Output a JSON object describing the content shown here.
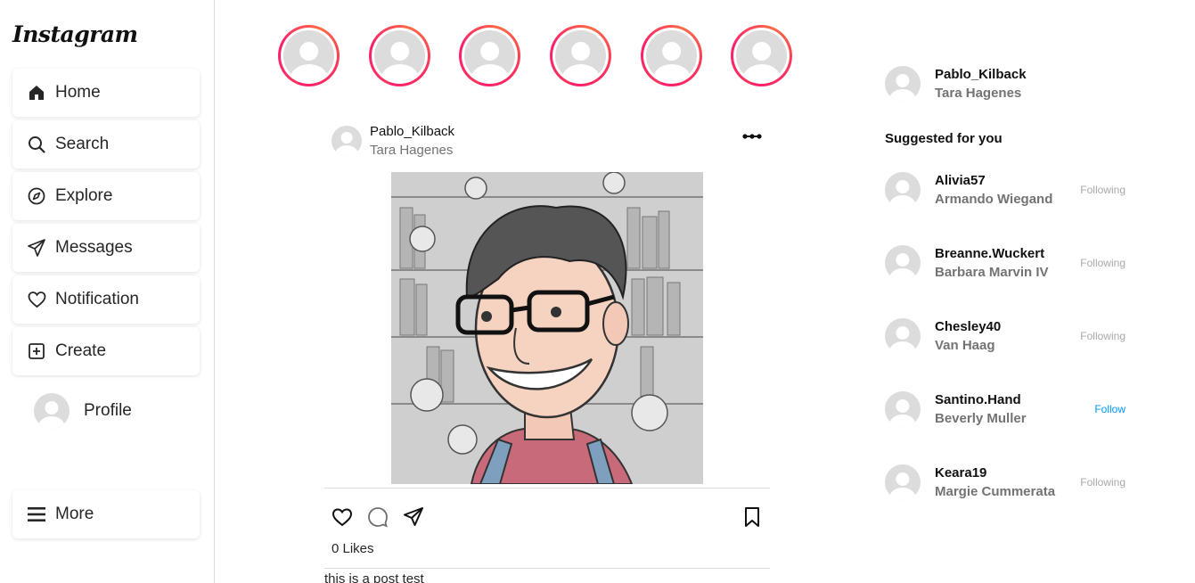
{
  "app": {
    "logo_text": "Instagram"
  },
  "sidebar": {
    "items": [
      {
        "label": "Home",
        "icon": "home-icon"
      },
      {
        "label": "Search",
        "icon": "search-icon"
      },
      {
        "label": "Explore",
        "icon": "compass-icon"
      },
      {
        "label": "Messages",
        "icon": "paper-plane-icon"
      },
      {
        "label": "Notification",
        "icon": "heart-icon"
      },
      {
        "label": "Create",
        "icon": "plus-square-icon"
      }
    ],
    "profile_label": "Profile",
    "more_label": "More",
    "more_icon": "hamburger-icon"
  },
  "stories": {
    "count": 6
  },
  "post": {
    "username": "Pablo_Kilback",
    "fullname": "Tara Hagenes",
    "likes_text": "0 Likes",
    "caption": "this is a post test",
    "image_description_icon": "cartoon-portrait-image"
  },
  "right_panel": {
    "current_user": {
      "username": "Pablo_Kilback",
      "fullname": "Tara Hagenes"
    },
    "suggested_title": "Suggested for you",
    "suggestions": [
      {
        "username": "Alivia57",
        "fullname": "Armando Wiegand",
        "action": "Following"
      },
      {
        "username": "Breanne.Wuckert",
        "fullname": "Barbara Marvin IV",
        "action": "Following"
      },
      {
        "username": "Chesley40",
        "fullname": "Van Haag",
        "action": "Following"
      },
      {
        "username": "Santino.Hand",
        "fullname": "Beverly Muller",
        "action": "Follow"
      },
      {
        "username": "Keara19",
        "fullname": "Margie Cummerata",
        "action": "Following"
      }
    ]
  },
  "colors": {
    "follow_blue": "#0095f6",
    "story_ring": "#f9365a",
    "muted": "#737373"
  }
}
